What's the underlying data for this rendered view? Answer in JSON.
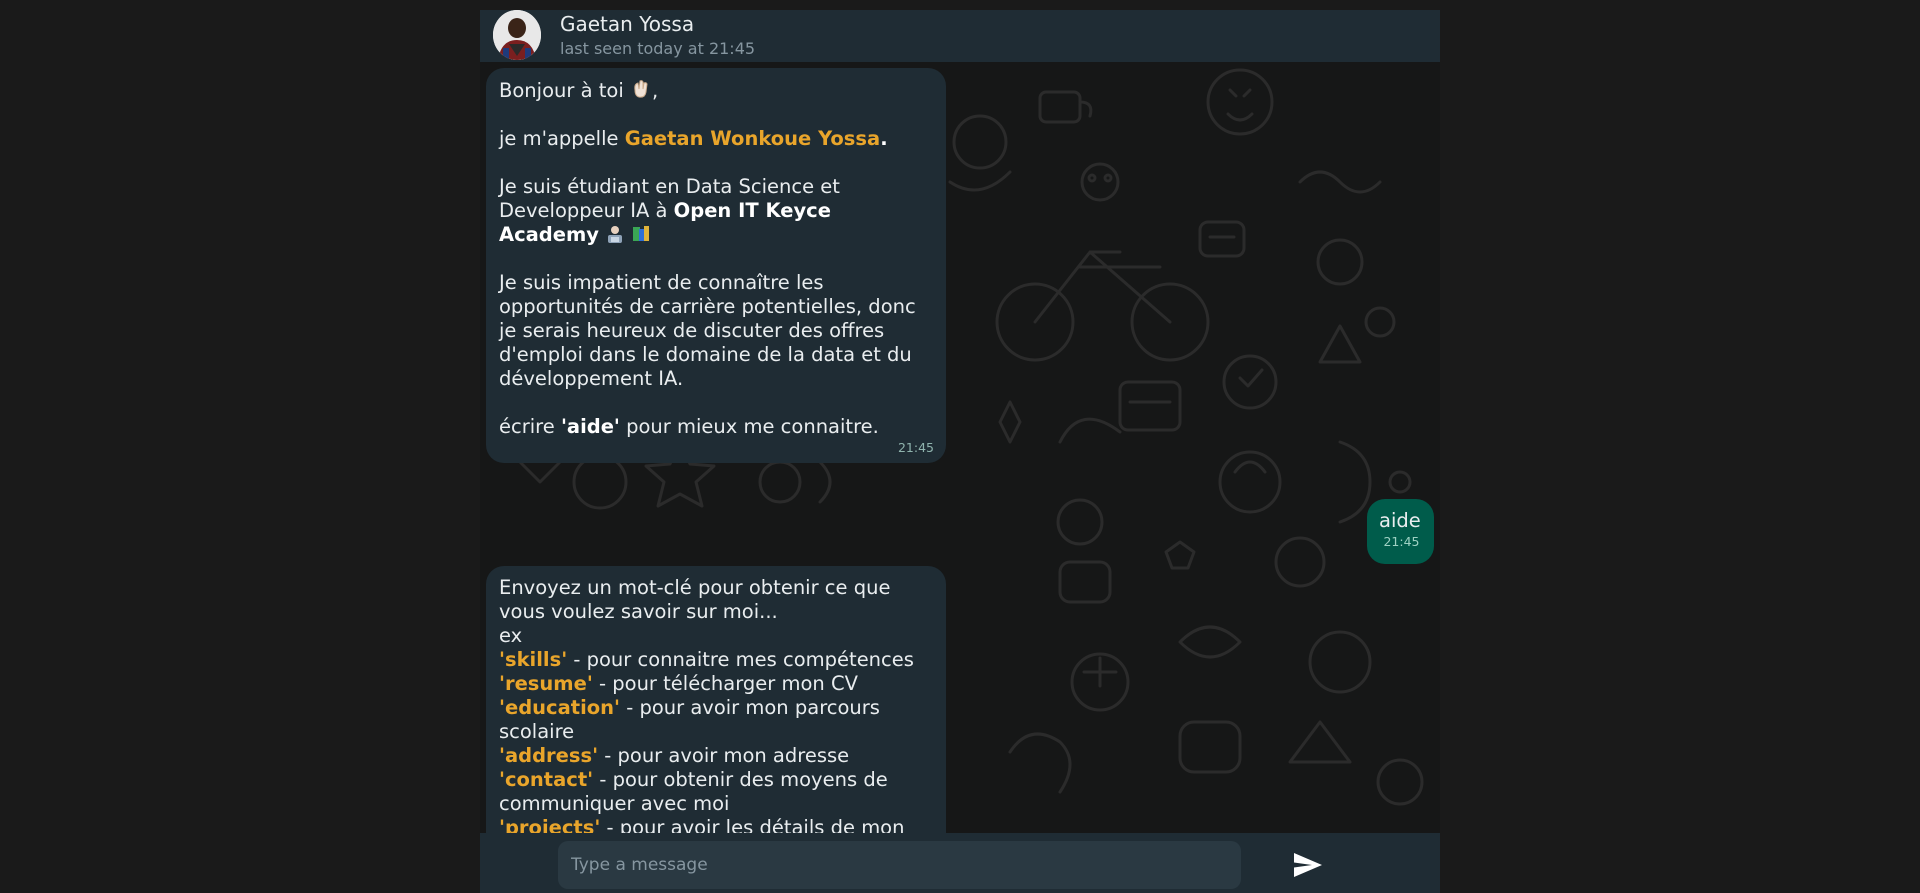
{
  "header": {
    "contact_name": "Gaetan Yossa",
    "status": "last seen today at 21:45"
  },
  "messages": {
    "welcome": {
      "greeting_prefix": "Bonjour à toi ",
      "greeting_suffix": ",",
      "intro_prefix": "je m'appelle ",
      "intro_name": "Gaetan Wonkoue Yossa",
      "intro_suffix": ".",
      "study_line1": "Je suis étudiant en Data Science et",
      "study_line2_prefix": "Developpeur IA à ",
      "study_line2_strong": "Open IT Keyce",
      "study_line3_strong": "Academy",
      "career_line1": "Je suis impatient de connaître les",
      "career_line2": "opportunités de carrière potentielles, donc",
      "career_line3": "je serais heureux de discuter des offres",
      "career_line4": "d'emploi dans le domaine de la data et du",
      "career_line5": "développement IA.",
      "help_prefix": "écrire ",
      "help_keyword": "'aide'",
      "help_suffix": " pour mieux me connaitre.",
      "time": "21:45"
    },
    "reply": {
      "text": "aide",
      "time": "21:45"
    },
    "keywords": {
      "line1": "Envoyez un mot-clé pour obtenir ce que",
      "line2": "vous voulez savoir sur moi...",
      "line3": "ex",
      "items": [
        {
          "keyword": "'skills'",
          "desc": " - pour connaitre mes compétences"
        },
        {
          "keyword": "'resume'",
          "desc": " - pour télécharger mon CV"
        },
        {
          "keyword": "'education'",
          "desc": " - pour avoir mon parcours"
        },
        {
          "keyword": "",
          "desc": "scolaire"
        },
        {
          "keyword": "'address'",
          "desc": " - pour avoir mon adresse"
        },
        {
          "keyword": "'contact'",
          "desc": " - pour obtenir des moyens de"
        },
        {
          "keyword": "",
          "desc": "communiquer avec moi"
        },
        {
          "keyword": "'projects'",
          "desc": " - pour avoir les détails de mon"
        }
      ]
    }
  },
  "composer": {
    "placeholder": "Type a message"
  },
  "icons": {
    "wave": "waving-hand-icon",
    "tech": "technologist-icon",
    "books": "books-icon",
    "send": "send-icon"
  },
  "colors": {
    "accent": "#e9a52b",
    "incoming_bubble": "#1f2c34",
    "outgoing_bubble": "#005c4b",
    "header": "#1f2c34"
  }
}
